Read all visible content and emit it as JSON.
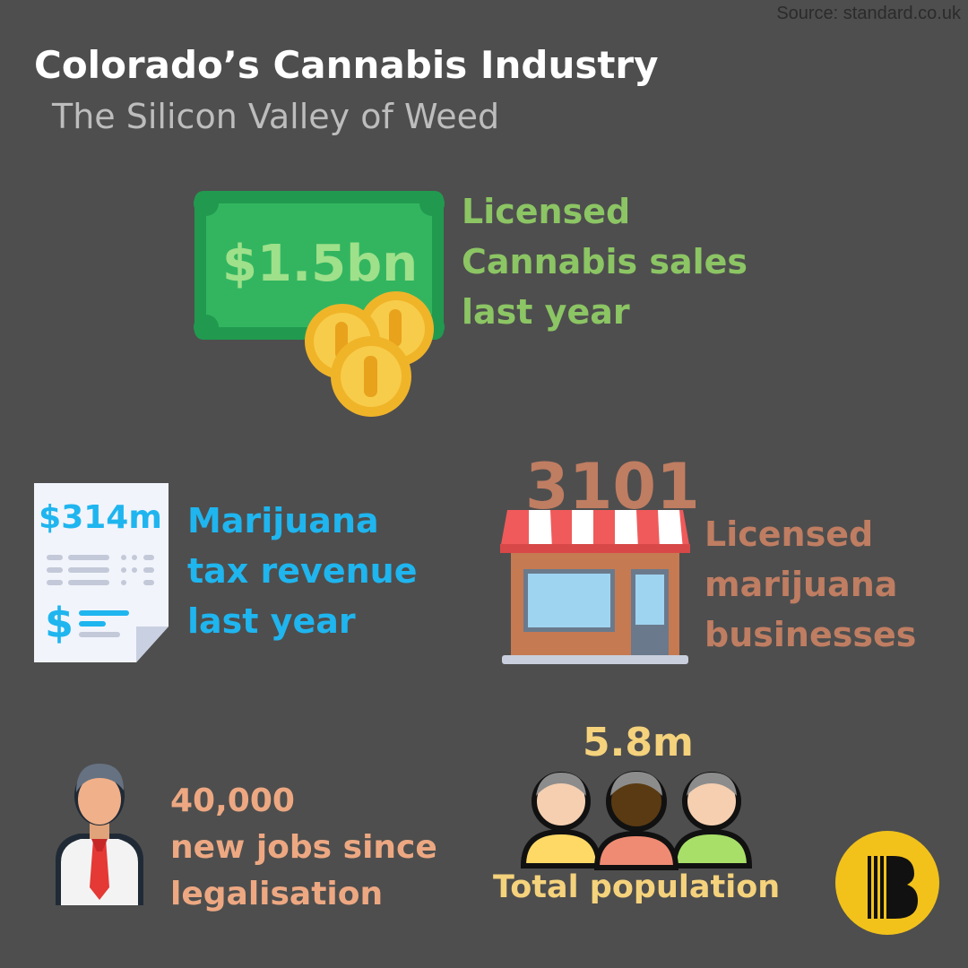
{
  "header": {
    "source": "Source: standard.co.uk",
    "title": "Colorado’s Cannabis Industry",
    "subtitle": "The Silicon Valley of Weed"
  },
  "stats": {
    "sales": {
      "value": "$1.5bn",
      "lines": [
        "Licensed",
        "Cannabis sales",
        "last year"
      ]
    },
    "tax": {
      "value": "$314m",
      "lines": [
        "Marijuana",
        "tax revenue",
        "last year"
      ]
    },
    "businesses": {
      "value": "3101",
      "lines": [
        "Licensed",
        "marijuana",
        "businesses"
      ]
    },
    "jobs": {
      "lines": [
        "40,000",
        "new jobs since",
        "legalisation"
      ]
    },
    "population": {
      "value": "5.8m",
      "label": "Total population"
    }
  },
  "colors": {
    "background": "#4e4e4e",
    "green": "#8cc564",
    "blue": "#1fb5ef",
    "brown": "#bf7d62",
    "peach": "#eda882",
    "gold": "#f5d27c"
  },
  "icons": {
    "sales": "money-bill-coins-icon",
    "tax": "tax-receipt-icon",
    "businesses": "storefront-icon",
    "jobs": "businessman-icon",
    "population": "people-group-icon",
    "brand": "brand-logo-icon"
  }
}
